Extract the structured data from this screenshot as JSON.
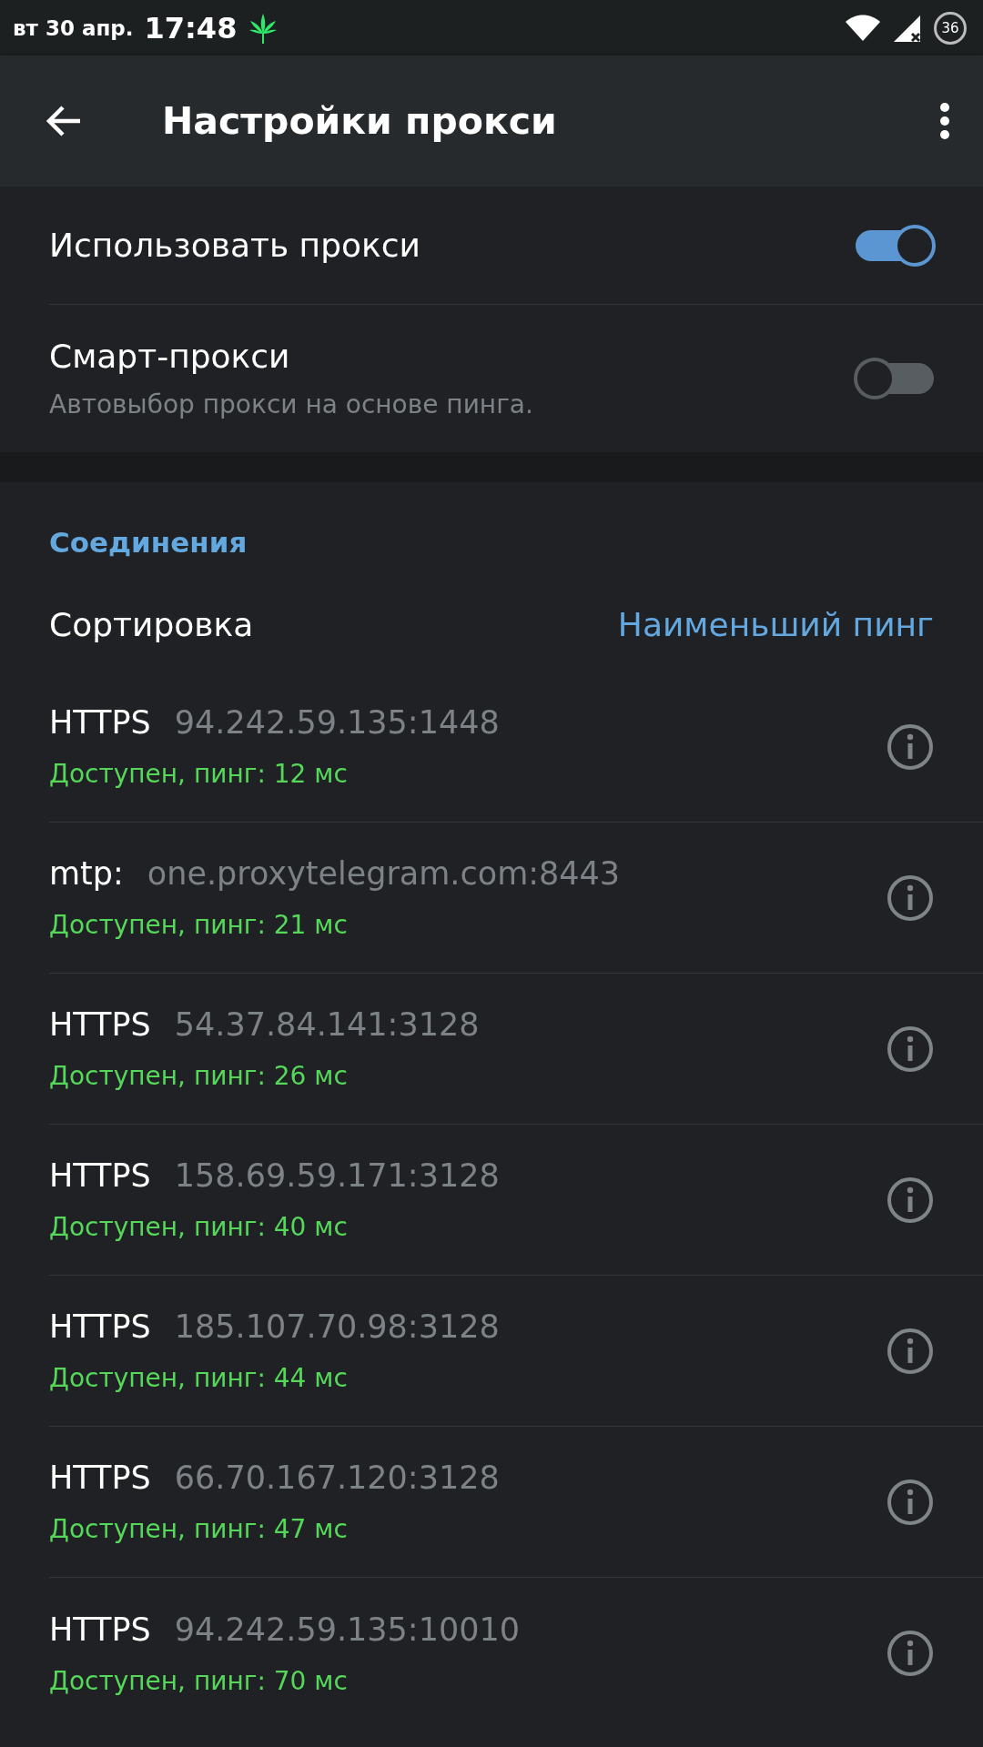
{
  "status_bar": {
    "date": "вт 30 апр.",
    "time": "17:48",
    "battery": "36"
  },
  "toolbar": {
    "title": "Настройки прокси"
  },
  "settings": [
    {
      "title": "Использовать прокси",
      "on": true
    },
    {
      "title": "Смарт-прокси",
      "subtitle": "Автовыбор прокси на основе пинга.",
      "on": false
    }
  ],
  "connections": {
    "header": "Соединения",
    "sort_label": "Сортировка",
    "sort_value": "Наименьший пинг",
    "proxies": [
      {
        "type": "HTTPS",
        "address": "94.242.59.135:1448",
        "status": "Доступен, пинг: 12  мс"
      },
      {
        "type": "mtp:",
        "address": "one.proxytelegram.com:8443",
        "status": "Доступен, пинг: 21  мс"
      },
      {
        "type": "HTTPS",
        "address": "54.37.84.141:3128",
        "status": "Доступен, пинг: 26  мс"
      },
      {
        "type": "HTTPS",
        "address": "158.69.59.171:3128",
        "status": "Доступен, пинг: 40  мс"
      },
      {
        "type": "HTTPS",
        "address": "185.107.70.98:3128",
        "status": "Доступен, пинг: 44  мс"
      },
      {
        "type": "HTTPS",
        "address": "66.70.167.120:3128",
        "status": "Доступен, пинг: 47  мс"
      },
      {
        "type": "HTTPS",
        "address": "94.242.59.135:10010",
        "status": "Доступен, пинг: 70  мс"
      }
    ]
  }
}
